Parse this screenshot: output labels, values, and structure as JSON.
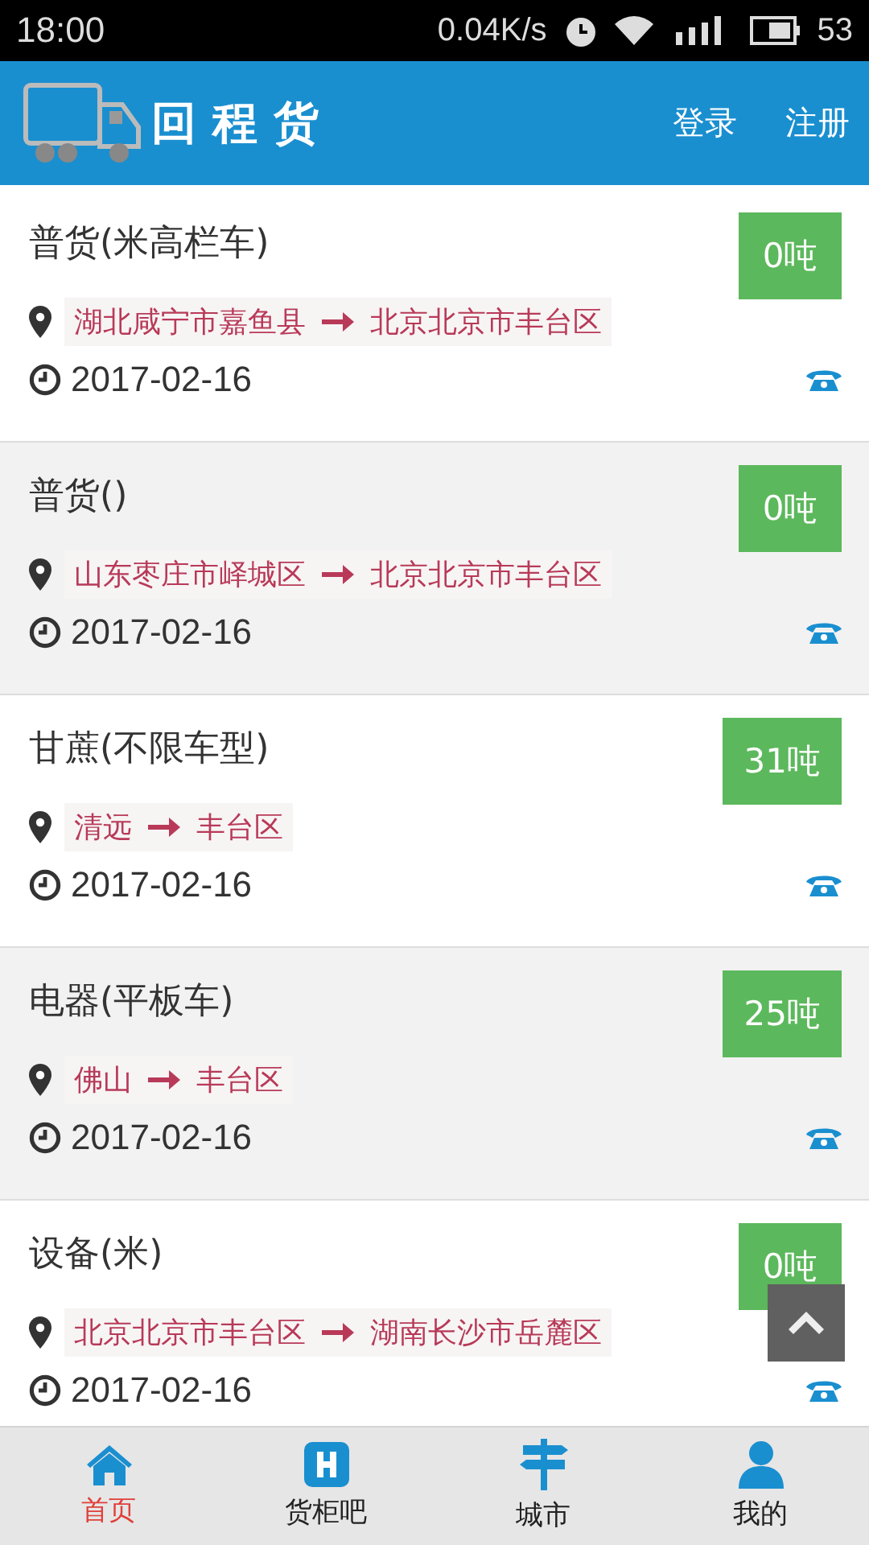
{
  "status_bar": {
    "time": "18:00",
    "speed": "0.04K/s",
    "battery": "53"
  },
  "header": {
    "logo_text": "回程货",
    "links": [
      "登录",
      "注册"
    ]
  },
  "cargo_list": [
    {
      "title": "普货(米高栏车)",
      "weight": "0吨",
      "from": "湖北咸宁市嘉鱼县",
      "to": "北京北京市丰台区",
      "date": "2017-02-16"
    },
    {
      "title": "普货()",
      "weight": "0吨",
      "from": "山东枣庄市峄城区",
      "to": "北京北京市丰台区",
      "date": "2017-02-16"
    },
    {
      "title": "甘蔗(不限车型)",
      "weight": "31吨",
      "from": "清远",
      "to": "丰台区",
      "date": "2017-02-16"
    },
    {
      "title": "电器(平板车)",
      "weight": "25吨",
      "from": "佛山",
      "to": "丰台区",
      "date": "2017-02-16"
    },
    {
      "title": "设备(米)",
      "weight": "0吨",
      "from": "北京北京市丰台区",
      "to": "湖南长沙市岳麓区",
      "date": "2017-02-16"
    }
  ],
  "bottom_nav": [
    {
      "label": "首页",
      "selected": true
    },
    {
      "label": "货柜吧",
      "selected": false
    },
    {
      "label": "城市",
      "selected": false
    },
    {
      "label": "我的",
      "selected": false
    }
  ]
}
